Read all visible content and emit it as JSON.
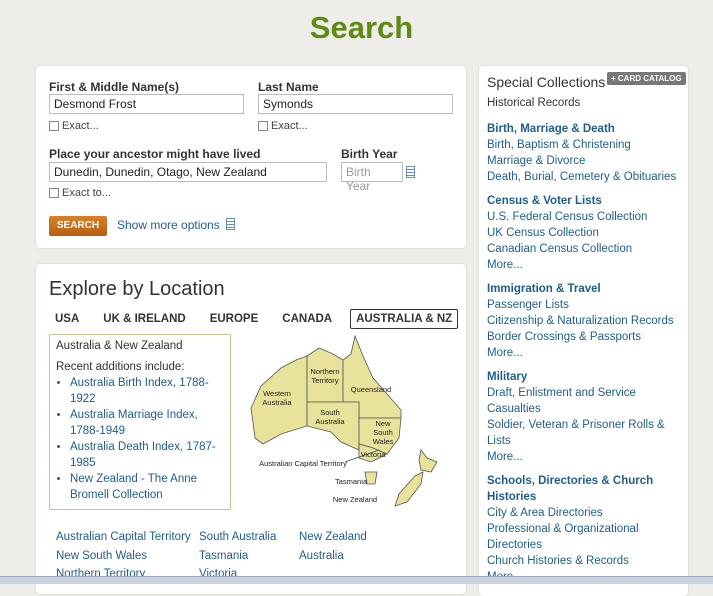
{
  "page_title": "Search",
  "search": {
    "first_name_label": "First & Middle Name(s)",
    "first_name_value": "Desmond Frost",
    "last_name_label": "Last Name",
    "last_name_value": "Symonds",
    "exact_label": "Exact...",
    "place_label": "Place your ancestor might have lived",
    "place_value": "Dunedin, Dunedin, Otago, New Zealand",
    "exact_to_label": "Exact to...",
    "birth_year_label": "Birth Year",
    "birth_year_placeholder": "Birth Year",
    "search_button": "SEARCH",
    "more_options": "Show more options"
  },
  "explore": {
    "title": "Explore by Location",
    "tabs": [
      "USA",
      "UK & IRELAND",
      "EUROPE",
      "CANADA",
      "AUSTRALIA & NZ"
    ],
    "active_tab": "AUSTRALIA & NZ",
    "region_title": "Australia & New Zealand",
    "recent_label": "Recent additions include:",
    "recent": [
      "Australia Birth Index, 1788-1922",
      "Australia Marriage Index, 1788-1949",
      "Australia Death Index, 1787-1985",
      "New Zealand - The Anne Bromell Collection"
    ],
    "map_labels": {
      "western_australia": [
        "Western",
        "Australia"
      ],
      "northern_territory": [
        "Northern",
        "Territory"
      ],
      "queensland": "Queensland",
      "south_australia": [
        "South",
        "Australia"
      ],
      "new_south_wales": [
        "New",
        "South",
        "Wales"
      ],
      "victoria": "Victoria",
      "act": "Australian Capital Territory",
      "tasmania": "Tasmania",
      "new_zealand": "New Zealand"
    },
    "locations_col1": [
      "Australian Capital Territory",
      "New South Wales",
      "Northern Territory"
    ],
    "locations_col2": [
      "South Australia",
      "Tasmania",
      "Victoria"
    ],
    "locations_col3": [
      "New Zealand",
      "Australia"
    ]
  },
  "special": {
    "title": "Special Collections",
    "catalog_button": "+ CARD CATALOG",
    "historical": "Historical Records",
    "sections": [
      {
        "heading": "Birth, Marriage & Death",
        "items": [
          "Birth, Baptism & Christening",
          "Marriage & Divorce",
          "Death, Burial, Cemetery & Obituaries"
        ],
        "more": ""
      },
      {
        "heading": "Census & Voter Lists",
        "items": [
          "U.S. Federal Census Collection",
          "UK Census Collection",
          "Canadian Census Collection"
        ],
        "more": "More..."
      },
      {
        "heading": "Immigration & Travel",
        "items": [
          "Passenger Lists",
          "Citizenship & Naturalization Records",
          "Border Crossings & Passports"
        ],
        "more": "More..."
      },
      {
        "heading": "Military",
        "items": [
          "Draft, Enlistment and Service",
          "Casualties",
          "Soldier, Veteran & Prisoner Rolls & Lists"
        ],
        "more": "More..."
      },
      {
        "heading": "Schools, Directories & Church Histories",
        "items": [
          "City & Area Directories",
          "Professional & Organizational Directories",
          "Church Histories & Records"
        ],
        "more": "More..."
      }
    ]
  },
  "colors": {
    "title_green": "#5e8a16",
    "link_blue": "#1f5e8c",
    "button_orange": "#c8701e",
    "map_fill": "#e8e29a"
  }
}
